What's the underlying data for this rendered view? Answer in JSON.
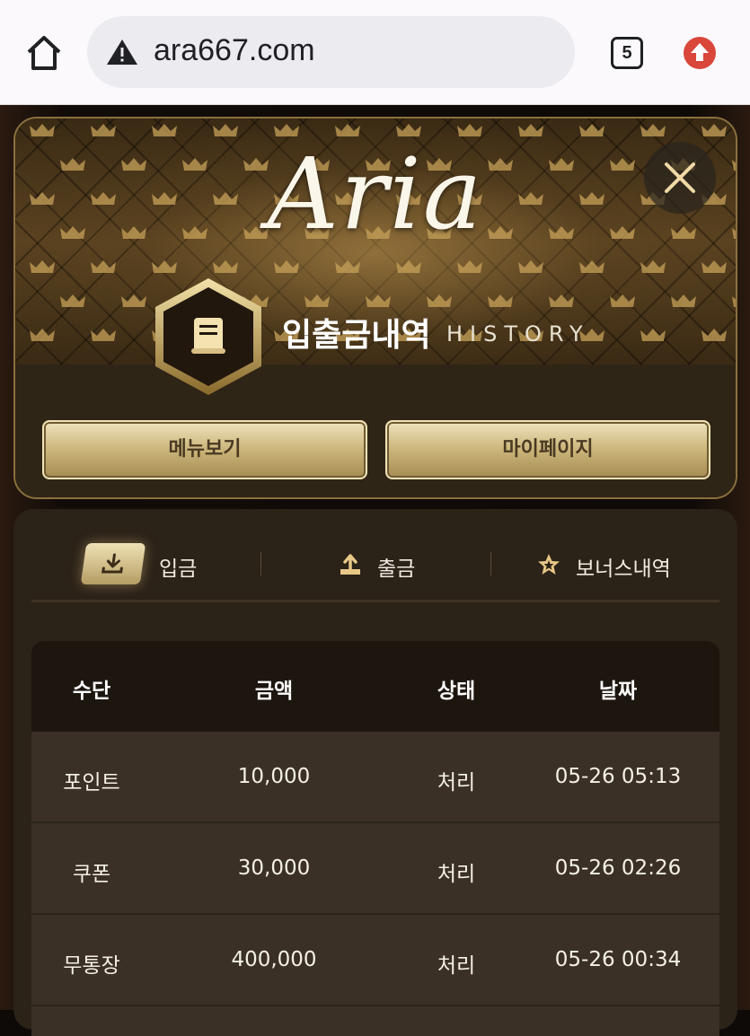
{
  "browser": {
    "url": "ara667.com",
    "tab_count": "5"
  },
  "header": {
    "logo": "Aria",
    "title_ko": "입출금내역",
    "title_en": "HISTORY",
    "menu_button": "메뉴보기",
    "mypage_button": "마이페이지"
  },
  "tabs": [
    {
      "label": "입금",
      "icon": "download-icon",
      "active": true
    },
    {
      "label": "출금",
      "icon": "upload-icon",
      "active": false
    },
    {
      "label": "보너스내역",
      "icon": "star-icon",
      "active": false
    }
  ],
  "table": {
    "headers": [
      "수단",
      "금액",
      "상태",
      "날짜"
    ],
    "rows": [
      [
        "포인트",
        "10,000",
        "처리",
        "05-26 05:13"
      ],
      [
        "쿠폰",
        "30,000",
        "처리",
        "05-26 02:26"
      ],
      [
        "무통장",
        "400,000",
        "처리",
        "05-26 00:34"
      ]
    ]
  },
  "colors": {
    "gold": "#cbb57a",
    "panel": "#2b2218",
    "table_header": "#1d160f",
    "table_row": "#3a3025"
  }
}
